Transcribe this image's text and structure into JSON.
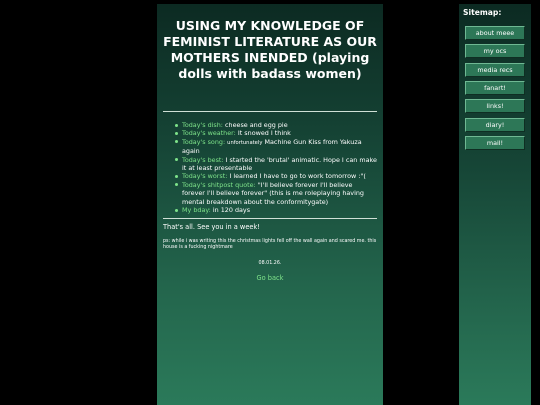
{
  "post": {
    "title": "USING MY KNOWLEDGE OF FEMINIST LITERATURE AS OUR MOTHERS INENDED (playing dolls with badass women)",
    "items": [
      {
        "label": "Today's dish:",
        "value": "cheese and egg pie"
      },
      {
        "label": "Today's weather:",
        "value": "It snowed I think"
      },
      {
        "label": "Today's song:",
        "prefix": "unfortunately",
        "value": "Machine Gun Kiss from Yakuza again"
      },
      {
        "label": "Today's best:",
        "value": "I started the 'brutal' animatic. Hope I can make it at least presentable"
      },
      {
        "label": "Today's worst:",
        "value": "I learned I have to go to work tomorrow :\"("
      },
      {
        "label": "Today's shitpost quote:",
        "value": "\"I'll believe forever I'll believe forever I'll believe forever\" (this is me roleplaying having mental breakdown about the conformitygate)"
      },
      {
        "label": "My bday:",
        "value": "in 120 days"
      }
    ],
    "sign_off": "That's all. See you in a week!",
    "ps": "ps: while i was writing this the christmas lights fell off the wall again and scared me. this house is a fucking nightmare",
    "date": "08.01.26.",
    "go_back": "Go back"
  },
  "sidebar": {
    "title": "Sitemap:",
    "links": [
      "about meee",
      "my ocs",
      "media recs",
      "fanart!",
      "links!",
      "diary!",
      "mail!"
    ]
  },
  "colors": {
    "background": "#000000",
    "accent_green": "#7ee38a",
    "button_green": "#2d7757",
    "panel_dark": "#0c2a22",
    "panel_light": "#2b7a5a"
  }
}
